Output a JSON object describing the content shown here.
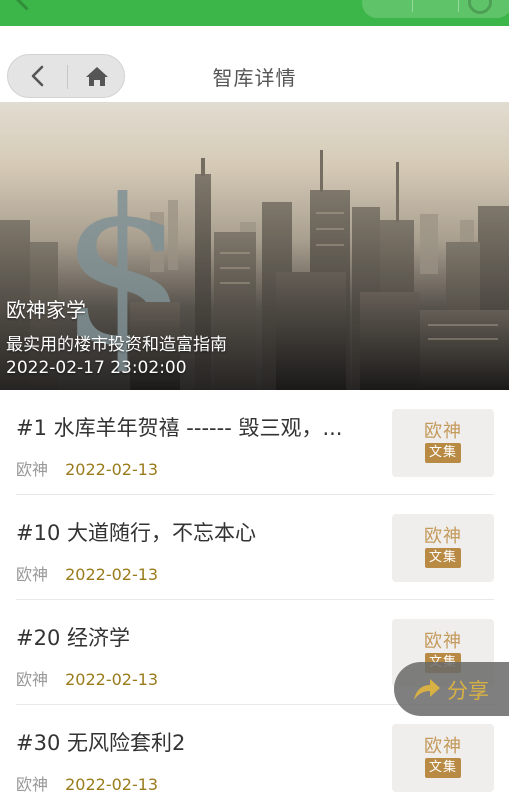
{
  "nav": {
    "title": "智库详情"
  },
  "hero": {
    "title": "欧神家学",
    "subtitle": "最实用的楼市投资和造富指南",
    "timestamp": "2022-02-17 23:02:00"
  },
  "articles": [
    {
      "title": "#1 水库羊年贺禧 ------ 毁三观，...",
      "author": "欧神",
      "date": "2022-02-13",
      "thumb_line1": "欧神",
      "thumb_line2": "文集"
    },
    {
      "title": "#10 大道随行，不忘本心",
      "author": "欧神",
      "date": "2022-02-13",
      "thumb_line1": "欧神",
      "thumb_line2": "文集"
    },
    {
      "title": "#20 经济学",
      "author": "欧神",
      "date": "2022-02-13",
      "thumb_line1": "欧神",
      "thumb_line2": "文集"
    },
    {
      "title": "#30 无风险套利2",
      "author": "欧神",
      "date": "2022-02-13",
      "thumb_line1": "欧神",
      "thumb_line2": "文集"
    }
  ],
  "share": {
    "label": "分享",
    "icon": "share-arrow-icon"
  },
  "colors": {
    "header_green": "#3cb648",
    "date_gold": "#9a7b1c",
    "share_gold": "#d9b044",
    "thumb_brown": "#b98a43"
  }
}
